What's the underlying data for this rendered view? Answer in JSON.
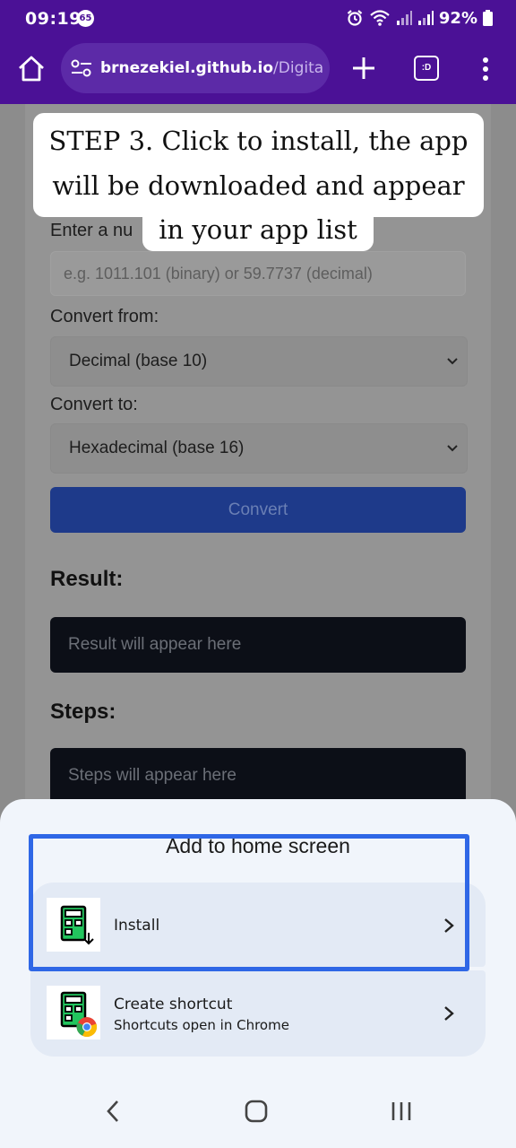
{
  "status_bar": {
    "time": "09:19",
    "notification_count": "65",
    "battery": "92%"
  },
  "browser": {
    "url_host": "brnezekiel.github.io",
    "url_path": "/Digital-Logic",
    "tabs_label": ":D"
  },
  "page": {
    "input_label": "Enter a nu",
    "input_placeholder": "e.g. 1011.101 (binary) or 59.7737 (decimal)",
    "convert_from_label": "Convert from:",
    "convert_from_value": "Decimal (base 10)",
    "convert_to_label": "Convert to:",
    "convert_to_value": "Hexadecimal (base 16)",
    "convert_button": "Convert",
    "result_heading": "Result:",
    "result_placeholder": "Result will appear here",
    "steps_heading": "Steps:",
    "steps_placeholder": "Steps will appear here"
  },
  "caption": {
    "line1": "STEP 3. Click to install, the app",
    "line2": "will be downloaded and appear",
    "line3": "in your app list"
  },
  "sheet": {
    "title": "Add to home screen",
    "options": [
      {
        "title": "Install",
        "subtitle": "",
        "icon": "calculator-install-icon"
      },
      {
        "title": "Create shortcut",
        "subtitle": "Shortcuts open in Chrome",
        "icon": "calculator-chrome-icon"
      }
    ]
  },
  "colors": {
    "browser_bar": "#4b1196",
    "highlight": "#2f67e6",
    "sheet_bg": "#f1f5fb",
    "app_icon_green": "#22c55e"
  }
}
